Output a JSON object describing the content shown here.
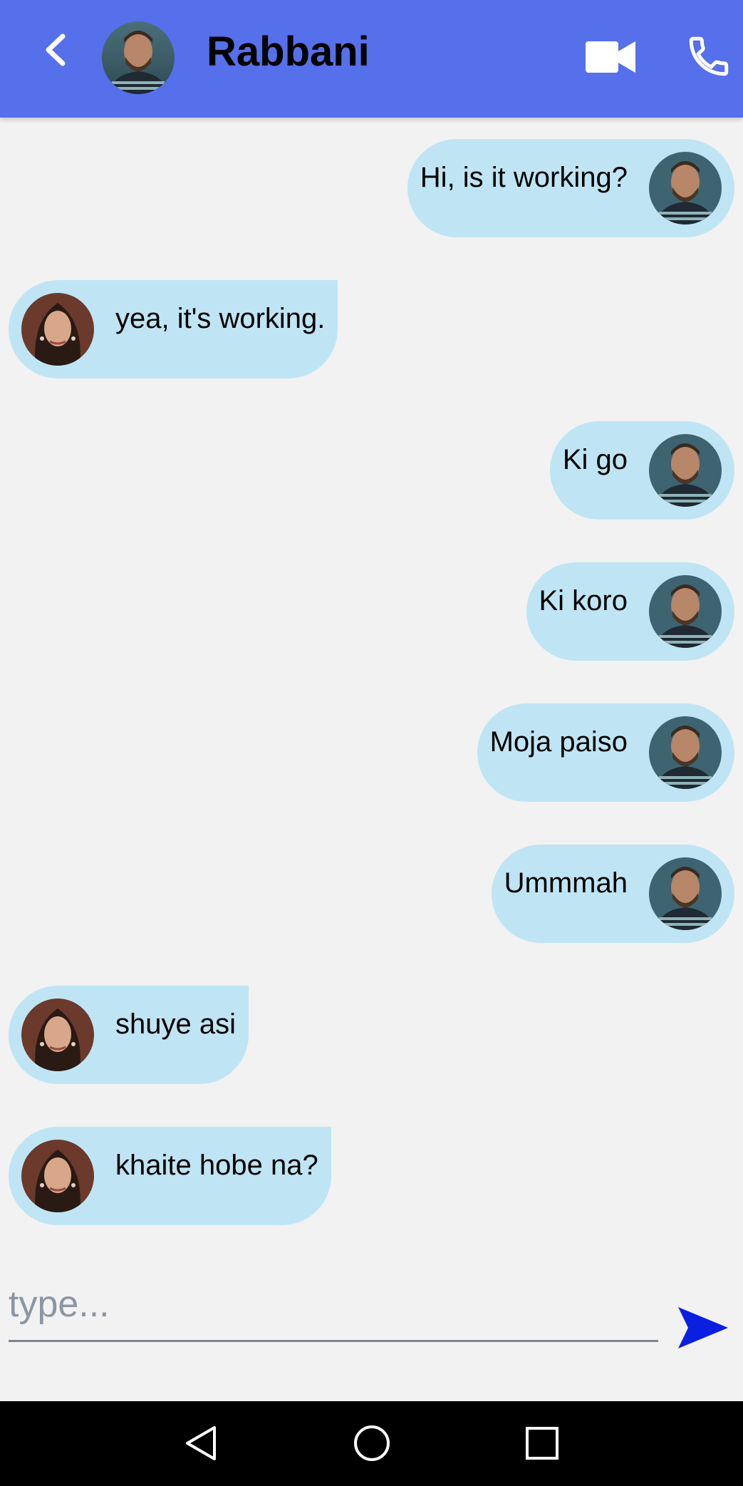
{
  "header": {
    "title": "Rabbani",
    "back_icon": "chevron-left-icon",
    "video_icon": "video-camera-icon",
    "call_icon": "phone-icon",
    "background": "#5570ea"
  },
  "messages": [
    {
      "side": "sent",
      "text": "Hi, is it working?"
    },
    {
      "side": "received",
      "text": "yea, it's working."
    },
    {
      "side": "sent",
      "text": "Ki go"
    },
    {
      "side": "sent",
      "text": "Ki koro"
    },
    {
      "side": "sent",
      "text": "Moja paiso"
    },
    {
      "side": "sent",
      "text": "Ummmah"
    },
    {
      "side": "received",
      "text": "shuye asi"
    },
    {
      "side": "received",
      "text": "khaite hobe na?"
    }
  ],
  "composer": {
    "placeholder": "type...",
    "value": "",
    "send_icon": "send-icon",
    "send_color": "#0a1fe0"
  },
  "bubble_color": "#bfe5f4",
  "navbar": {
    "back_icon": "triangle-back-icon",
    "home_icon": "circle-home-icon",
    "recents_icon": "square-recents-icon"
  }
}
